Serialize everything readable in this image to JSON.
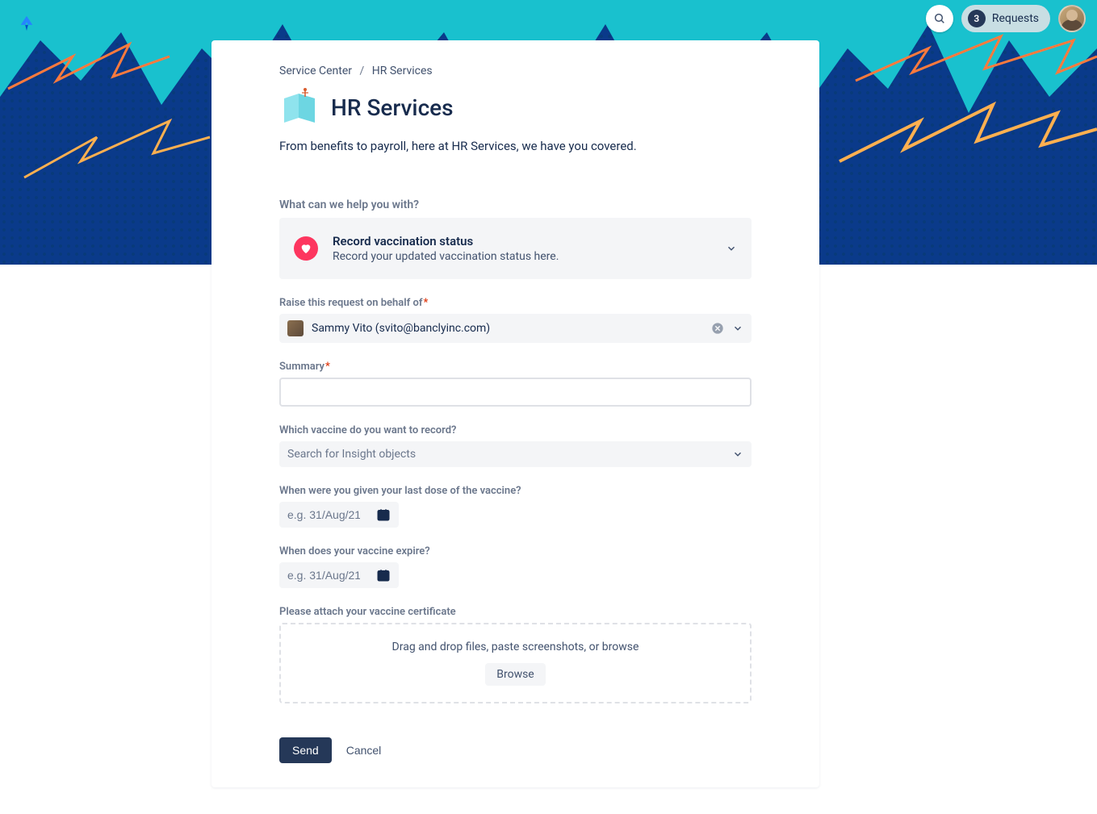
{
  "header": {
    "requests_count": "3",
    "requests_label": "Requests"
  },
  "breadcrumb": {
    "root": "Service Center",
    "current": "HR Services"
  },
  "page": {
    "title": "HR Services",
    "description": "From benefits to payroll, here at HR Services, we have you covered."
  },
  "form": {
    "help_label": "What can we help you with?",
    "help_card": {
      "title": "Record vaccination status",
      "subtitle": "Record your updated vaccination status here."
    },
    "behalf_label": "Raise this request on behalf of",
    "behalf_value": "Sammy Vito (svito@banclyinc.com)",
    "summary_label": "Summary",
    "summary_value": "",
    "vaccine_label": "Which vaccine do you want to record?",
    "vaccine_placeholder": "Search for Insight objects",
    "last_dose_label": "When were you given your last dose of the vaccine?",
    "expire_label": "When does your vaccine expire?",
    "date_placeholder": "e.g. 31/Aug/21",
    "attach_label": "Please attach your vaccine certificate",
    "dropzone_text": "Drag and drop files, paste screenshots, or browse",
    "browse_label": "Browse",
    "send_label": "Send",
    "cancel_label": "Cancel"
  }
}
